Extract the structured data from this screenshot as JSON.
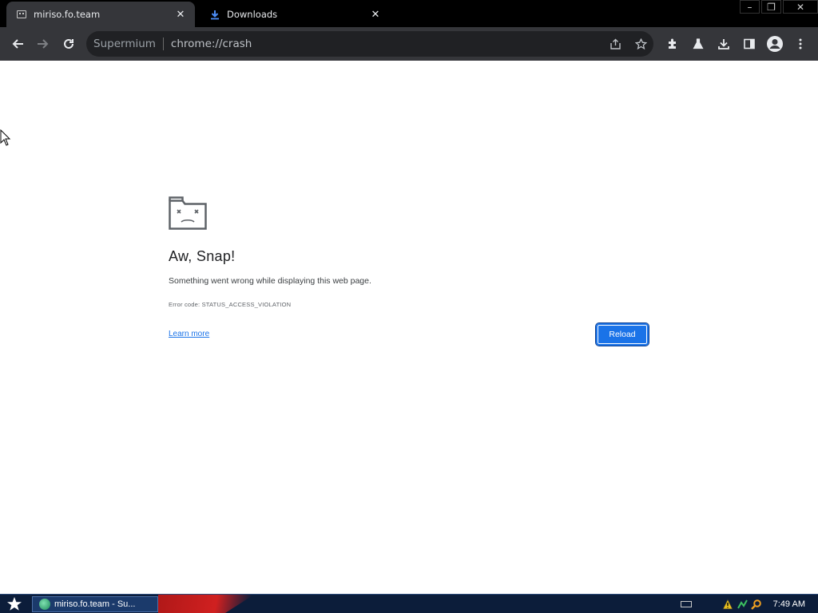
{
  "tabs": [
    {
      "title": "miriso.fo.team",
      "icon": "sad-tab-icon",
      "active": true
    },
    {
      "title": "Downloads",
      "icon": "download-icon",
      "active": false
    }
  ],
  "window_controls": {
    "minimize": "–",
    "restore": "❐",
    "close": "✕"
  },
  "omnibox": {
    "site_label": "Supermium",
    "url": "chrome://crash"
  },
  "toolbar_icons": [
    "back-icon",
    "forward-icon",
    "reload-icon",
    "share-icon",
    "star-icon",
    "extensions-icon",
    "labs-icon",
    "download-icon",
    "side-panel-icon",
    "profile-icon",
    "menu-icon"
  ],
  "crash_page": {
    "heading": "Aw, Snap!",
    "message": "Something went wrong while displaying this web page.",
    "error_code": "Error code: STATUS_ACCESS_VIOLATION",
    "learn_more": "Learn more",
    "reload_button": "Reload"
  },
  "taskbar": {
    "task_label": "miriso.fo.team - Su...",
    "clock": "7:49 AM"
  },
  "colors": {
    "accent": "#1a73e8",
    "toolbar": "#35363a",
    "taskbar": "#0c1d3a"
  }
}
